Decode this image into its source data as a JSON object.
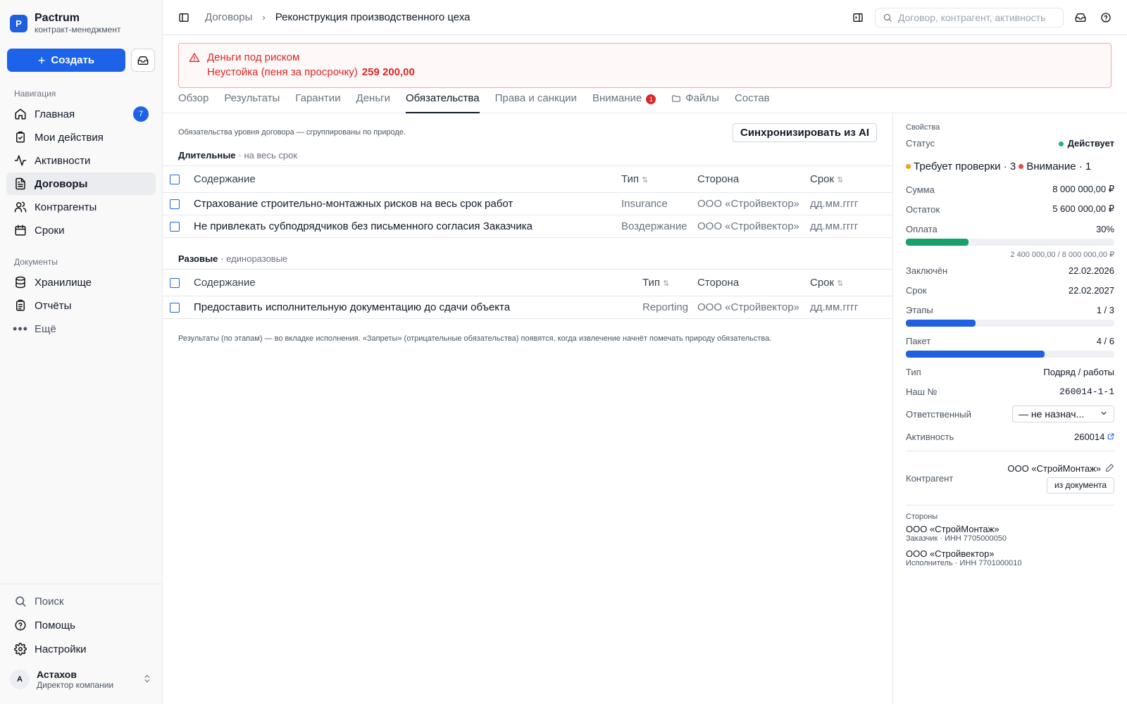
{
  "brand": {
    "name": "Pactrum",
    "subtitle": "контракт-менеджмент",
    "logo_letter": "P"
  },
  "sidebar": {
    "create_label": "Создать",
    "nav_section": "Навигация",
    "nav": [
      {
        "label": "Главная",
        "icon": "home-icon",
        "badge": "7"
      },
      {
        "label": "Мои действия",
        "icon": "clipboard-icon"
      },
      {
        "label": "Активности",
        "icon": "activity-icon"
      },
      {
        "label": "Договоры",
        "icon": "document-icon",
        "active": true
      },
      {
        "label": "Контрагенты",
        "icon": "users-icon"
      },
      {
        "label": "Сроки",
        "icon": "calendar-icon"
      }
    ],
    "docs_section": "Документы",
    "docs": [
      {
        "label": "Хранилище",
        "icon": "database-icon"
      },
      {
        "label": "Отчёты",
        "icon": "report-icon"
      },
      {
        "label": "Ещё",
        "icon": "more-icon"
      }
    ],
    "bottom": [
      {
        "label": "Поиск",
        "icon": "search-icon"
      },
      {
        "label": "Помощь",
        "icon": "help-icon"
      },
      {
        "label": "Настройки",
        "icon": "settings-icon"
      }
    ],
    "user": {
      "initial": "А",
      "name": "Астахов",
      "role": "Директор компании"
    }
  },
  "topbar": {
    "breadcrumb_parent": "Договоры",
    "breadcrumb_current": "Реконструкция производственного цеха",
    "search_placeholder": "Договор, контрагент, активность"
  },
  "alert": {
    "title": "Деньги под риском",
    "line_label": "Неустойка (пеня за просрочку)",
    "line_amount": "259 200,00"
  },
  "tabs": [
    {
      "label": "Обзор"
    },
    {
      "label": "Результаты"
    },
    {
      "label": "Гарантии"
    },
    {
      "label": "Деньги"
    },
    {
      "label": "Обязательства",
      "active": true
    },
    {
      "label": "Права и санкции"
    },
    {
      "label": "Внимание",
      "badge": "1"
    },
    {
      "label": "Файлы",
      "icon": "folder-icon"
    },
    {
      "label": "Состав"
    }
  ],
  "content": {
    "description": "Обязательства уровня договора — сгруппированы по природе.",
    "sync_label": "Синхронизировать из AI",
    "columns": {
      "content": "Содержание",
      "type": "Тип",
      "party": "Сторона",
      "term": "Срок"
    },
    "groups": [
      {
        "title": "Длительные",
        "subtitle": "· на весь срок",
        "rows": [
          {
            "text": "Страхование строительно-монтажных рисков на весь срок работ",
            "type": "Insurance",
            "party": "ООО «Стройвектор»",
            "term": "дд.мм.гггг"
          },
          {
            "text": "Не привлекать субподрядчиков без письменного согласия Заказчика",
            "type": "Воздержание",
            "party": "ООО «Стройвектор»",
            "term": "дд.мм.гггг"
          }
        ]
      },
      {
        "title": "Разовые",
        "subtitle": "· единоразовые",
        "rows": [
          {
            "text": "Предоставить исполнительную документацию до сдачи объекта",
            "type": "Reporting",
            "party": "ООО «Стройвектор»",
            "term": "дд.мм.гггг"
          }
        ]
      }
    ],
    "footnote": "Результаты (по этапам) — во вкладке исполнения. «Запреты» (отрицательные обязательства) появятся, когда извлечение начнёт помечать природу обязательства."
  },
  "panel": {
    "section": "Свойства",
    "status_label": "Статус",
    "status_value": "Действует",
    "flag_review": "Требует проверки · 3",
    "flag_attention": "Внимание · 1",
    "sum_label": "Сумма",
    "sum_value": "8 000 000,00 ₽",
    "rest_label": "Остаток",
    "rest_value": "5 600 000,00 ₽",
    "pay_label": "Оплата",
    "pay_value": "30%",
    "pay_fraction": 0.3,
    "pay_sub": "2 400 000,00 / 8 000 000,00 ₽",
    "signed_label": "Заключён",
    "signed_value": "22.02.2026",
    "term_label": "Срок",
    "term_value": "22.02.2027",
    "stages_label": "Этапы",
    "stages_value": "1 / 3",
    "stages_fraction": 0.333,
    "pack_label": "Пакет",
    "pack_value": "4 / 6",
    "pack_fraction": 0.667,
    "type_label": "Тип",
    "type_value": "Подряд / работы",
    "our_no_label": "Наш №",
    "our_no_value": "260014-1-1",
    "resp_label": "Ответственный",
    "resp_value": "— не назнач...",
    "activity_label": "Активность",
    "activity_value": "260014",
    "counterparty_label": "Контрагент",
    "counterparty_value": "ООО «СтройМонтаж»",
    "from_doc_label": "из документа",
    "parties_label": "Стороны",
    "parties": [
      {
        "name": "ООО «СтройМонтаж»",
        "sub": "Заказчик · ИНН 7705000050"
      },
      {
        "name": "ООО «Стройвектор»",
        "sub": "Исполнитель · ИНН 7701000010"
      }
    ],
    "colors": {
      "pay": "#16a06a",
      "progress": "#2160e0",
      "review": "#f59e0b",
      "attention": "#ef4444"
    }
  }
}
